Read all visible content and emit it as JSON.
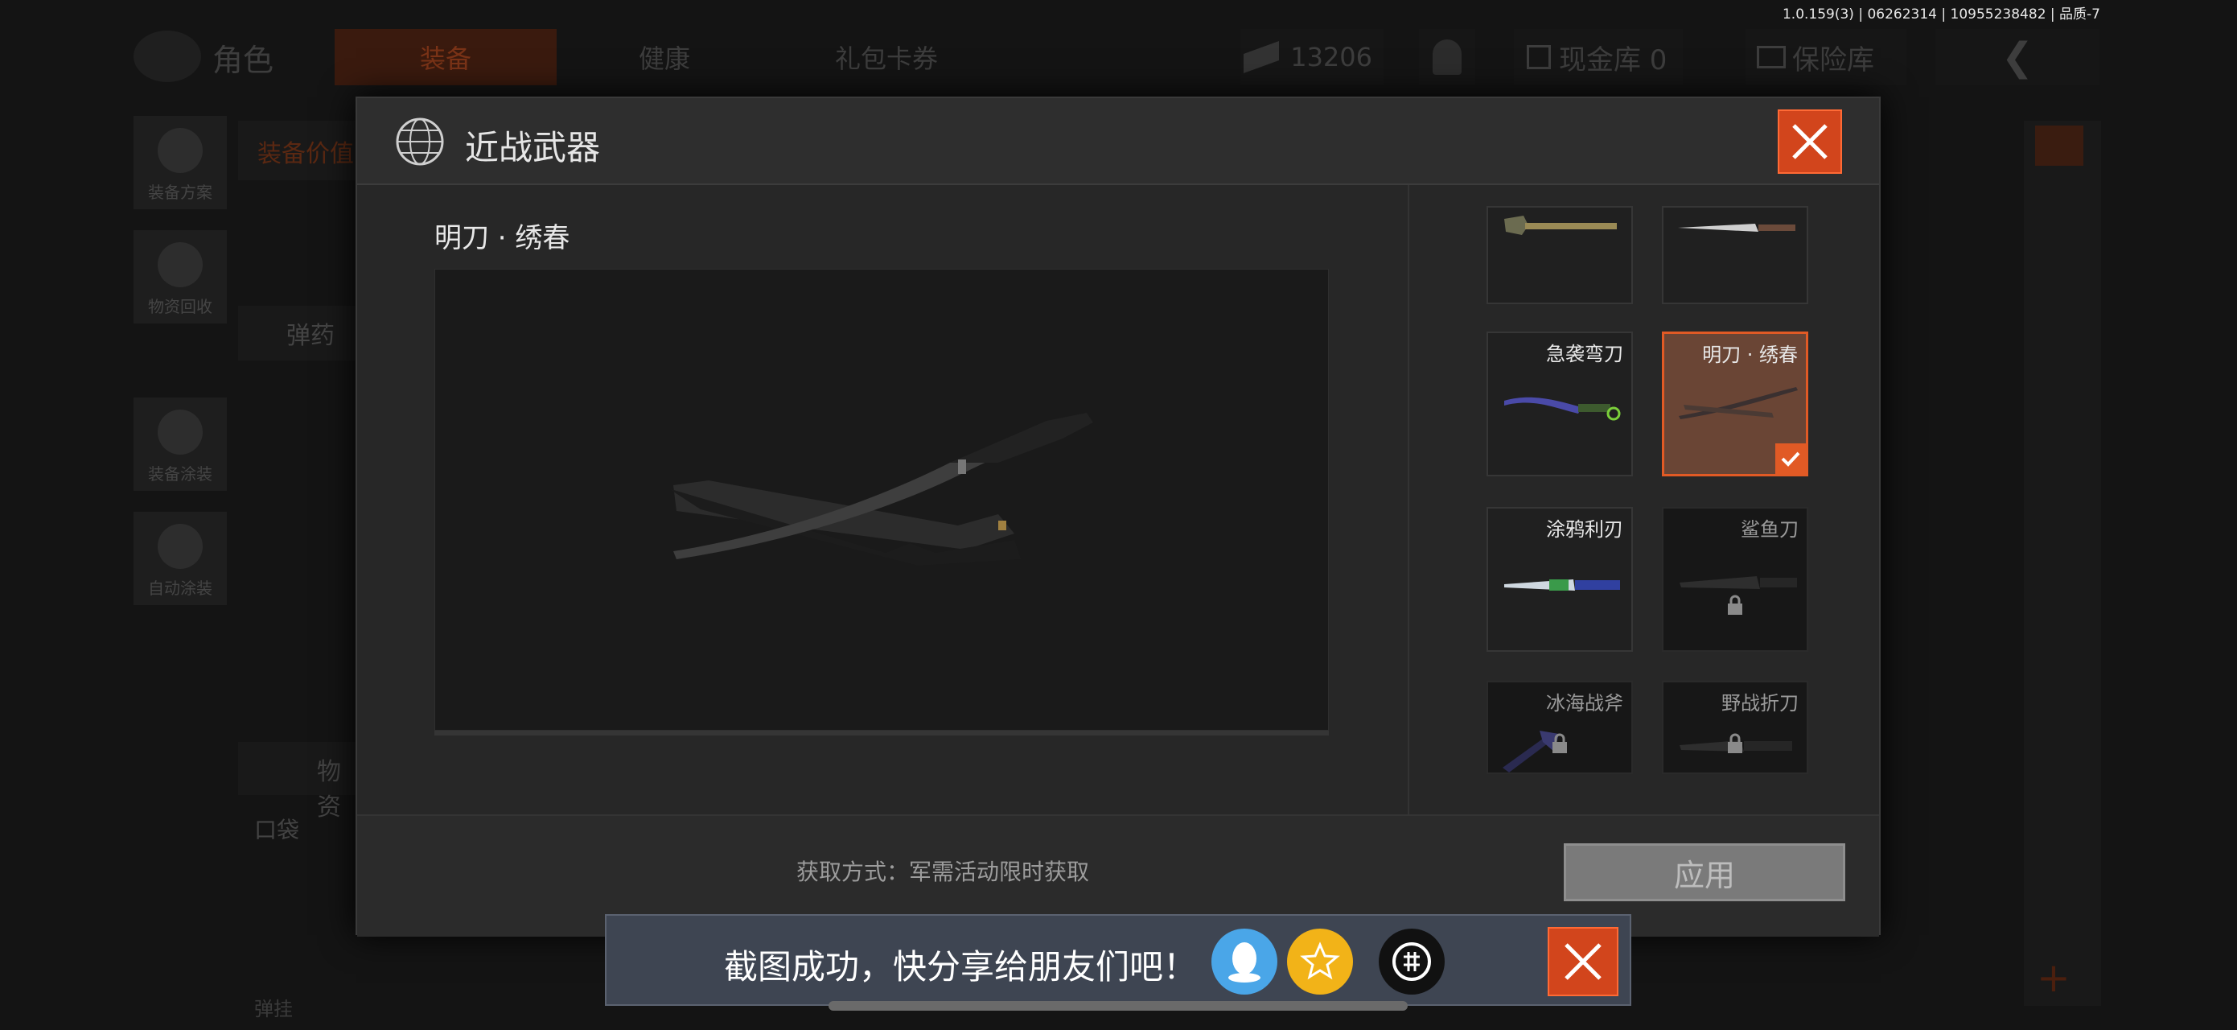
{
  "version_text": "1.0.159(3) | 06262314 | 10955238482 | 品质-7",
  "topbar": {
    "title": "角色",
    "tabs": [
      {
        "label": "装备",
        "active": true
      },
      {
        "label": "健康",
        "active": false
      },
      {
        "label": "礼包卡券",
        "active": false
      }
    ],
    "currency_value": "13206",
    "cash_vault": "现金库 0",
    "safe_box": "保险库"
  },
  "sidebar": {
    "items": [
      {
        "label": "装备方案"
      },
      {
        "label": "物资回收"
      },
      {
        "label": "装备涂装"
      },
      {
        "label": "自动涂装"
      }
    ]
  },
  "background_fragments": {
    "equip_value": "装备价值",
    "ammo": "弹药",
    "supplies": "物资",
    "pocket": "口袋",
    "misc": "弹挂"
  },
  "modal": {
    "title": "近战武器",
    "icon": "globe-icon",
    "selected_item_name": "明刀 · 绣春",
    "acquire_text": "获取方式：军需活动限时获取",
    "apply_label": "应用",
    "items": [
      {
        "label": "",
        "locked": false,
        "selected": false,
        "icon": "shovel-icon"
      },
      {
        "label": "",
        "locked": false,
        "selected": false,
        "icon": "dagger-icon"
      },
      {
        "label": "急袭弯刀",
        "locked": false,
        "selected": false,
        "icon": "karambit-icon"
      },
      {
        "label": "明刀 · 绣春",
        "locked": false,
        "selected": true,
        "icon": "katana-icon"
      },
      {
        "label": "涂鸦利刃",
        "locked": false,
        "selected": false,
        "icon": "blade-icon"
      },
      {
        "label": "鲨鱼刀",
        "locked": true,
        "selected": false,
        "icon": "knife-icon"
      },
      {
        "label": "冰海战斧",
        "locked": true,
        "selected": false,
        "icon": "axe-icon"
      },
      {
        "label": "野战折刀",
        "locked": true,
        "selected": false,
        "icon": "folding-knife-icon"
      }
    ]
  },
  "toast": {
    "text": "截图成功，快分享给朋友们吧！",
    "share_targets": [
      "qq-icon",
      "qzone-icon",
      "app-icon"
    ]
  },
  "colors": {
    "accent": "#e15a25",
    "modal_bg": "#272727",
    "toast_bg": "#3e4552"
  }
}
